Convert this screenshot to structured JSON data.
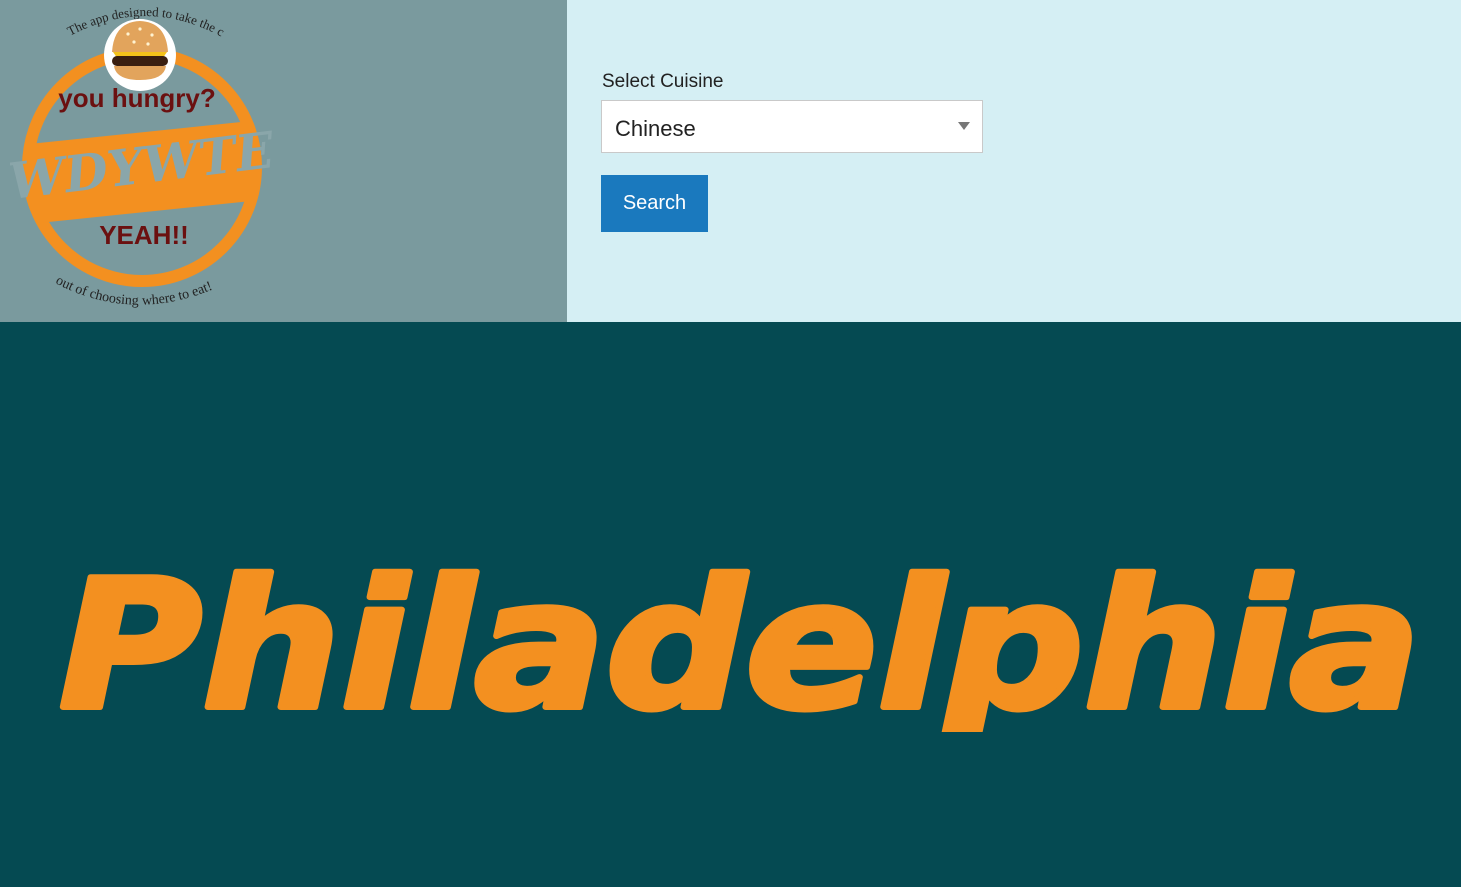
{
  "logo": {
    "tagline_top": "The app designed to take the chore",
    "line1": "you hungry?",
    "banner": "WDYWTE",
    "line2": "YEAH!!",
    "tagline_bottom": "out of choosing where to eat!"
  },
  "form": {
    "label": "Select Cuisine",
    "selected_value": "Chinese",
    "search_label": "Search"
  },
  "city": {
    "name": "Philadelphia"
  },
  "colors": {
    "logo_panel": "#7a9a9e",
    "form_panel": "#d5eff4",
    "bottom_panel": "#054a52",
    "accent_orange": "#f39020",
    "button_blue": "#1a79be",
    "logo_text_red": "#6b1010"
  },
  "icons": {
    "logo_mascot": "burger-icon",
    "select_arrow": "chevron-down-icon"
  }
}
